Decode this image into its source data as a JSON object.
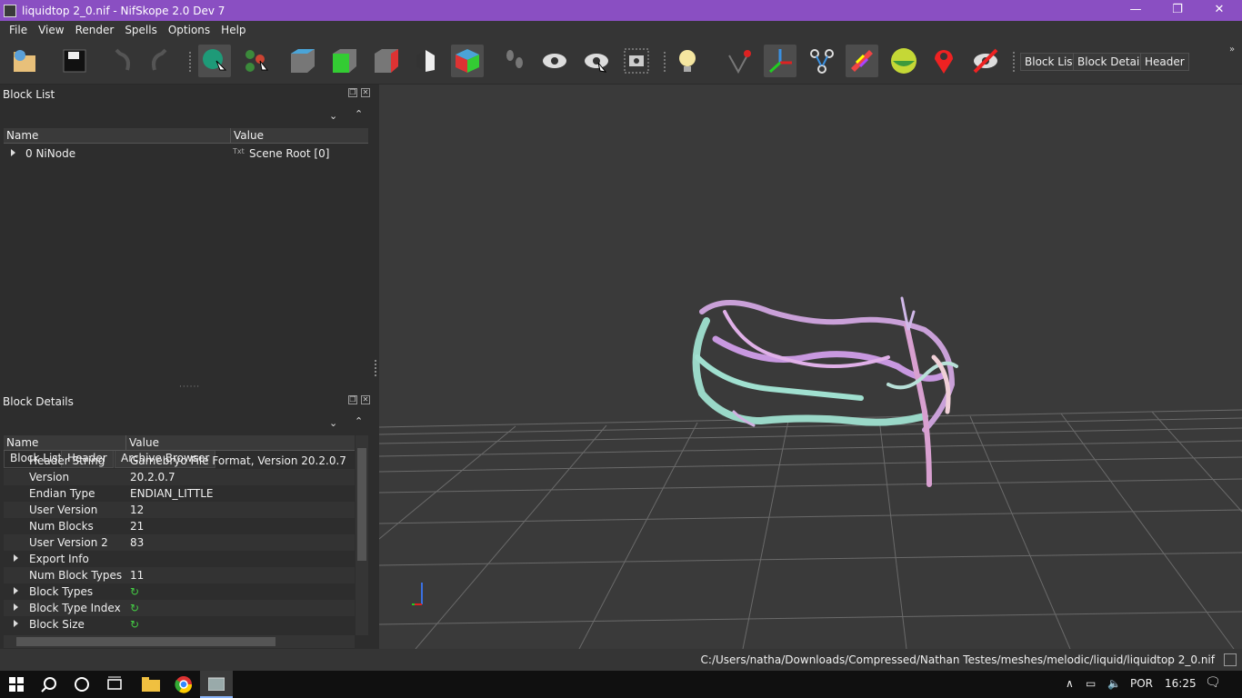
{
  "window": {
    "title": "liquidtop 2_0.nif - NifSkope 2.0 Dev 7",
    "minimize": "—",
    "maximize": "❐",
    "close": "✕"
  },
  "menu": [
    "File",
    "View",
    "Render",
    "Spells",
    "Options",
    "Help"
  ],
  "toolbar": {
    "block_list_button": "Block List",
    "block_details_button": "Block Details",
    "header_button": "Header"
  },
  "block_list": {
    "title": "Block List",
    "col_name": "Name",
    "col_value": "Value",
    "rows": [
      {
        "name": "0 NiNode",
        "value": "Scene Root [0]"
      }
    ]
  },
  "tabs": [
    "Block List",
    "Header",
    "Archive Browser"
  ],
  "block_details": {
    "title": "Block Details",
    "col_name": "Name",
    "col_value": "Value",
    "rows": [
      {
        "name": "Header String",
        "value": "Gamebryo File Format, Version 20.2.0.7"
      },
      {
        "name": "Version",
        "value": "20.2.0.7"
      },
      {
        "name": "Endian Type",
        "value": "ENDIAN_LITTLE"
      },
      {
        "name": "User Version",
        "value": "12"
      },
      {
        "name": "Num Blocks",
        "value": "21"
      },
      {
        "name": "User Version 2",
        "value": "83"
      },
      {
        "name": "Export Info",
        "value": ""
      },
      {
        "name": "Num Block Types",
        "value": "11"
      },
      {
        "name": "Block Types",
        "value": ""
      },
      {
        "name": "Block Type Index",
        "value": ""
      },
      {
        "name": "Block Size",
        "value": ""
      }
    ]
  },
  "status": {
    "path": "C:/Users/natha/Downloads/Compressed/Nathan Testes/meshes/melodic/liquid/liquidtop 2_0.nif"
  },
  "taskbar": {
    "language": "POR",
    "time": "16:25"
  }
}
